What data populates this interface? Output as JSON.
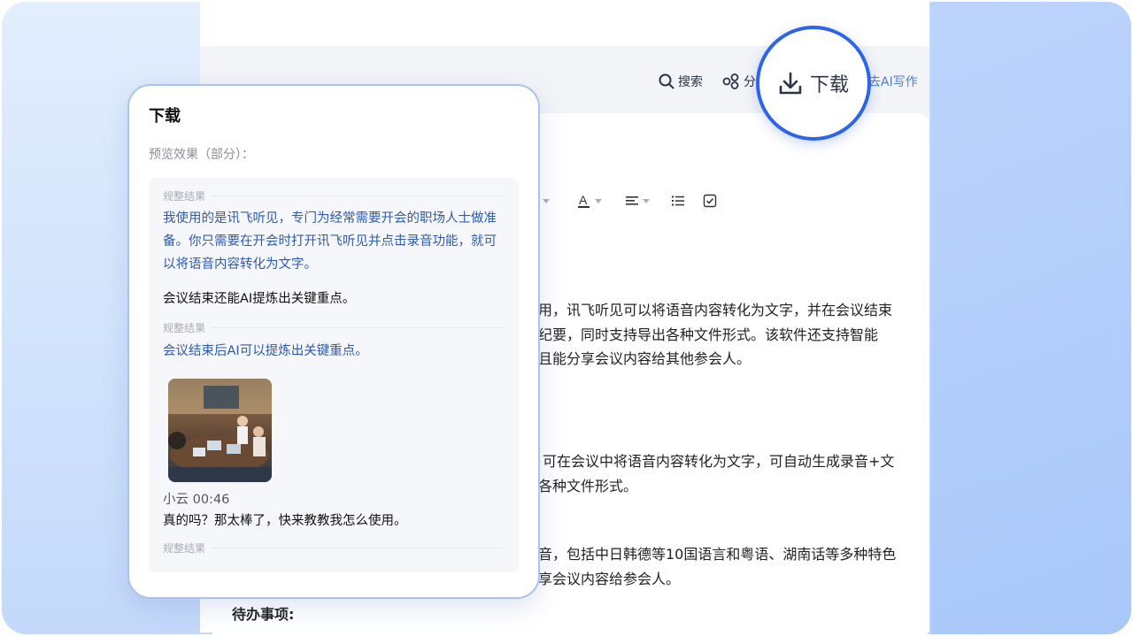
{
  "toolbar": {
    "search_label": "搜索",
    "share_label": "分",
    "download_label": "下载",
    "ai_write_label": "去AI写作"
  },
  "document": {
    "paragraphs": [
      [
        "应用，讯飞听见可以将语音内容转化为文字，并在会议结束",
        "议纪要，同时支持导出各种文件形式。该软件还支持智能",
        "并且能分享会议内容给其他参会人。"
      ],
      [
        "可在会议中将语音内容转化为文字，可自动生成录音+文",
        "出各种文件形式。"
      ],
      [
        "录音，包括中日韩德等10国语言和粤语、湖南话等多种特色",
        "分享会议内容给参会人。"
      ]
    ],
    "todo_label": "待办事项:"
  },
  "popup": {
    "title": "下载",
    "subtitle": "预览效果（部分）：",
    "label1": "规整结果",
    "text1": "我使用的是讯飞听见，专门为经常需要开会的职场人士做准备。你只需要在开会时打开讯飞听见并点击录音功能，就可以将语音内容转化为文字。",
    "raw2": "会议结束还能AI提炼出关键重点。",
    "label2": "规整结果",
    "text2": "会议结束后AI可以提炼出关键重点。",
    "speaker_meta": "小云   00:46",
    "raw3": "真的吗？那太棒了，快来教教我怎么使用。",
    "label3": "规整结果"
  },
  "colors": {
    "accent": "#2d64ec",
    "result_text": "#2e5bb0"
  }
}
